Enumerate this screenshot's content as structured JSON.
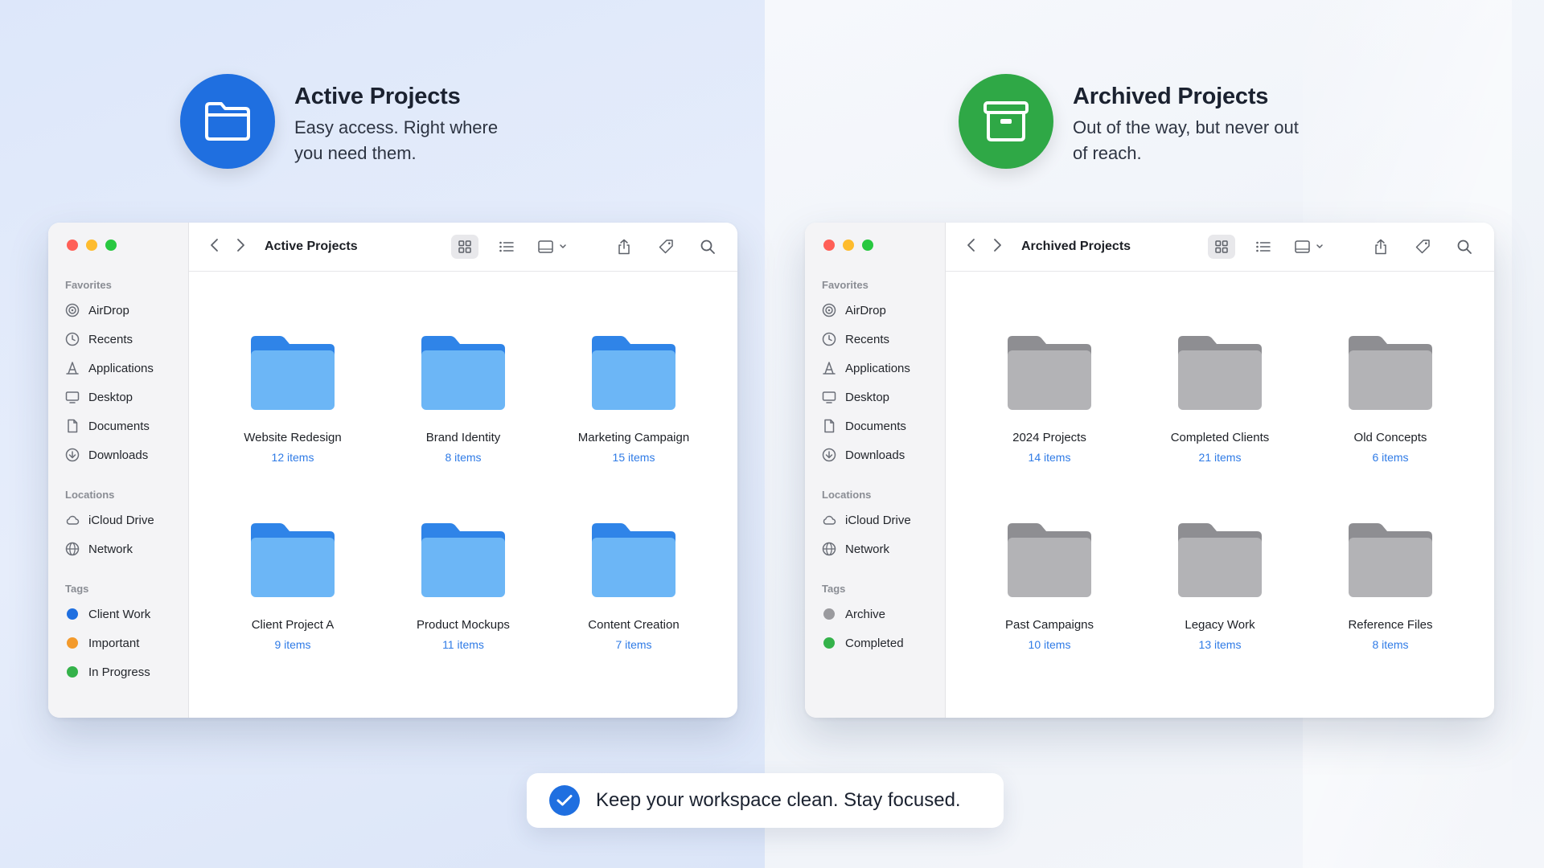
{
  "colors": {
    "active_accent": "#1f6fe0",
    "archive_accent": "#2fa846",
    "active_folder": "#6cb6f6",
    "archive_folder": "#b3b3b6",
    "link_blue": "#2f7be6"
  },
  "active": {
    "title": "Active Projects",
    "subtitle": "Easy access. Right where you need them.",
    "icon": "folder-icon",
    "window": {
      "toolbar_title": "Active Projects",
      "sidebar": {
        "favorites_label": "Favorites",
        "favorites": [
          {
            "label": "AirDrop",
            "icon": "airdrop-icon"
          },
          {
            "label": "Recents",
            "icon": "clock-icon"
          },
          {
            "label": "Applications",
            "icon": "applications-icon"
          },
          {
            "label": "Desktop",
            "icon": "desktop-icon"
          },
          {
            "label": "Documents",
            "icon": "document-icon"
          },
          {
            "label": "Downloads",
            "icon": "download-icon"
          }
        ],
        "locations_label": "Locations",
        "locations": [
          {
            "label": "iCloud Drive",
            "icon": "cloud-icon"
          },
          {
            "label": "Network",
            "icon": "globe-icon"
          }
        ],
        "tags_label": "Tags",
        "tags": [
          {
            "label": "Client Work",
            "color": "#1f6fe0"
          },
          {
            "label": "Important",
            "color": "#f39a2c"
          },
          {
            "label": "In Progress",
            "color": "#34b24a"
          }
        ]
      },
      "folders": [
        {
          "name": "Website Redesign",
          "count": "12 items"
        },
        {
          "name": "Brand Identity",
          "count": "8 items"
        },
        {
          "name": "Marketing Campaign",
          "count": "15 items"
        },
        {
          "name": "Client Project A",
          "count": "9 items"
        },
        {
          "name": "Product Mockups",
          "count": "11 items"
        },
        {
          "name": "Content Creation",
          "count": "7 items"
        }
      ]
    }
  },
  "archived": {
    "title": "Archived Projects",
    "subtitle": "Out of the way, but never out of reach.",
    "icon": "archive-box-icon",
    "window": {
      "toolbar_title": "Archived Projects",
      "sidebar": {
        "favorites_label": "Favorites",
        "favorites": [
          {
            "label": "AirDrop",
            "icon": "airdrop-icon"
          },
          {
            "label": "Recents",
            "icon": "clock-icon"
          },
          {
            "label": "Applications",
            "icon": "applications-icon"
          },
          {
            "label": "Desktop",
            "icon": "desktop-icon"
          },
          {
            "label": "Documents",
            "icon": "document-icon"
          },
          {
            "label": "Downloads",
            "icon": "download-icon"
          }
        ],
        "locations_label": "Locations",
        "locations": [
          {
            "label": "iCloud Drive",
            "icon": "cloud-icon"
          },
          {
            "label": "Network",
            "icon": "globe-icon"
          }
        ],
        "tags_label": "Tags",
        "tags": [
          {
            "label": "Archive",
            "color": "#9a9a9e"
          },
          {
            "label": "Completed",
            "color": "#34b24a"
          }
        ]
      },
      "folders": [
        {
          "name": "2024 Projects",
          "count": "14 items"
        },
        {
          "name": "Completed Clients",
          "count": "21 items"
        },
        {
          "name": "Old Concepts",
          "count": "6 items"
        },
        {
          "name": "Past Campaigns",
          "count": "10 items"
        },
        {
          "name": "Legacy Work",
          "count": "13 items"
        },
        {
          "name": "Reference Files",
          "count": "8 items"
        }
      ]
    }
  },
  "banner": {
    "text": "Keep your workspace clean. Stay focused.",
    "icon": "checkmark-icon"
  }
}
